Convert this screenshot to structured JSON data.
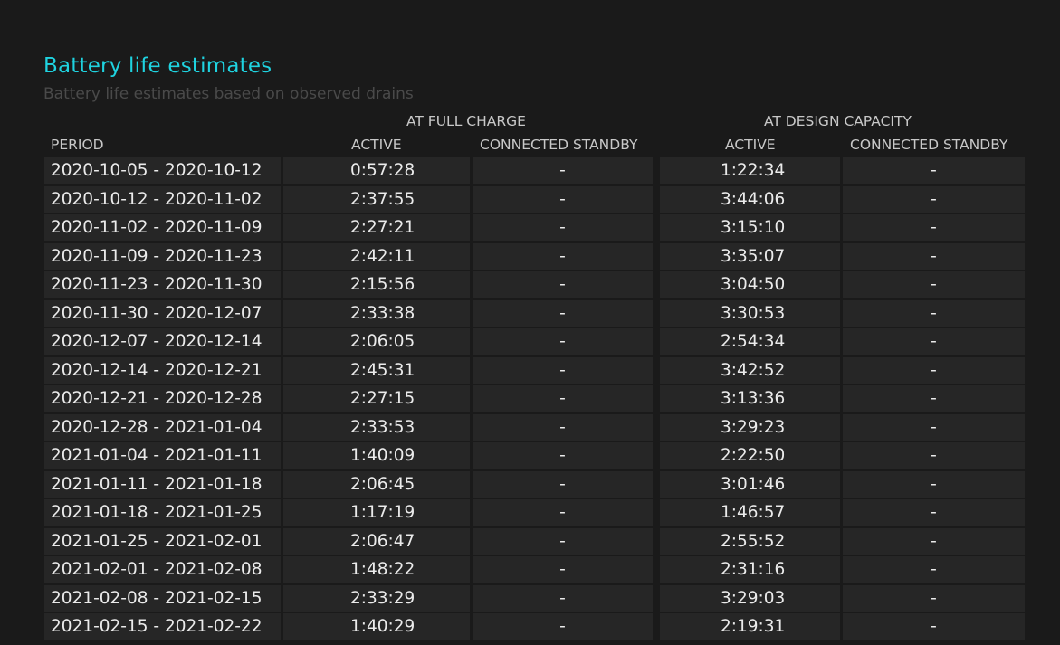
{
  "header": {
    "title": "Battery life estimates",
    "subtitle": "Battery life estimates based on observed drains"
  },
  "table": {
    "groups": {
      "full_charge": "AT FULL CHARGE",
      "design_capacity": "AT DESIGN CAPACITY"
    },
    "columns": {
      "period": "PERIOD",
      "full_active": "ACTIVE",
      "full_standby": "CONNECTED STANDBY",
      "design_active": "ACTIVE",
      "design_standby": "CONNECTED STANDBY"
    },
    "rows": [
      {
        "period": "2020-10-05 - 2020-10-12",
        "full_active": "0:57:28",
        "full_standby": "-",
        "design_active": "1:22:34",
        "design_standby": "-"
      },
      {
        "period": "2020-10-12 - 2020-11-02",
        "full_active": "2:37:55",
        "full_standby": "-",
        "design_active": "3:44:06",
        "design_standby": "-"
      },
      {
        "period": "2020-11-02 - 2020-11-09",
        "full_active": "2:27:21",
        "full_standby": "-",
        "design_active": "3:15:10",
        "design_standby": "-"
      },
      {
        "period": "2020-11-09 - 2020-11-23",
        "full_active": "2:42:11",
        "full_standby": "-",
        "design_active": "3:35:07",
        "design_standby": "-"
      },
      {
        "period": "2020-11-23 - 2020-11-30",
        "full_active": "2:15:56",
        "full_standby": "-",
        "design_active": "3:04:50",
        "design_standby": "-"
      },
      {
        "period": "2020-11-30 - 2020-12-07",
        "full_active": "2:33:38",
        "full_standby": "-",
        "design_active": "3:30:53",
        "design_standby": "-"
      },
      {
        "period": "2020-12-07 - 2020-12-14",
        "full_active": "2:06:05",
        "full_standby": "-",
        "design_active": "2:54:34",
        "design_standby": "-"
      },
      {
        "period": "2020-12-14 - 2020-12-21",
        "full_active": "2:45:31",
        "full_standby": "-",
        "design_active": "3:42:52",
        "design_standby": "-"
      },
      {
        "period": "2020-12-21 - 2020-12-28",
        "full_active": "2:27:15",
        "full_standby": "-",
        "design_active": "3:13:36",
        "design_standby": "-"
      },
      {
        "period": "2020-12-28 - 2021-01-04",
        "full_active": "2:33:53",
        "full_standby": "-",
        "design_active": "3:29:23",
        "design_standby": "-"
      },
      {
        "period": "2021-01-04 - 2021-01-11",
        "full_active": "1:40:09",
        "full_standby": "-",
        "design_active": "2:22:50",
        "design_standby": "-"
      },
      {
        "period": "2021-01-11 - 2021-01-18",
        "full_active": "2:06:45",
        "full_standby": "-",
        "design_active": "3:01:46",
        "design_standby": "-"
      },
      {
        "period": "2021-01-18 - 2021-01-25",
        "full_active": "1:17:19",
        "full_standby": "-",
        "design_active": "1:46:57",
        "design_standby": "-"
      },
      {
        "period": "2021-01-25 - 2021-02-01",
        "full_active": "2:06:47",
        "full_standby": "-",
        "design_active": "2:55:52",
        "design_standby": "-"
      },
      {
        "period": "2021-02-01 - 2021-02-08",
        "full_active": "1:48:22",
        "full_standby": "-",
        "design_active": "2:31:16",
        "design_standby": "-"
      },
      {
        "period": "2021-02-08 - 2021-02-15",
        "full_active": "2:33:29",
        "full_standby": "-",
        "design_active": "3:29:03",
        "design_standby": "-"
      },
      {
        "period": "2021-02-15 - 2021-02-22",
        "full_active": "1:40:29",
        "full_standby": "-",
        "design_active": "2:19:31",
        "design_standby": "-"
      }
    ]
  }
}
